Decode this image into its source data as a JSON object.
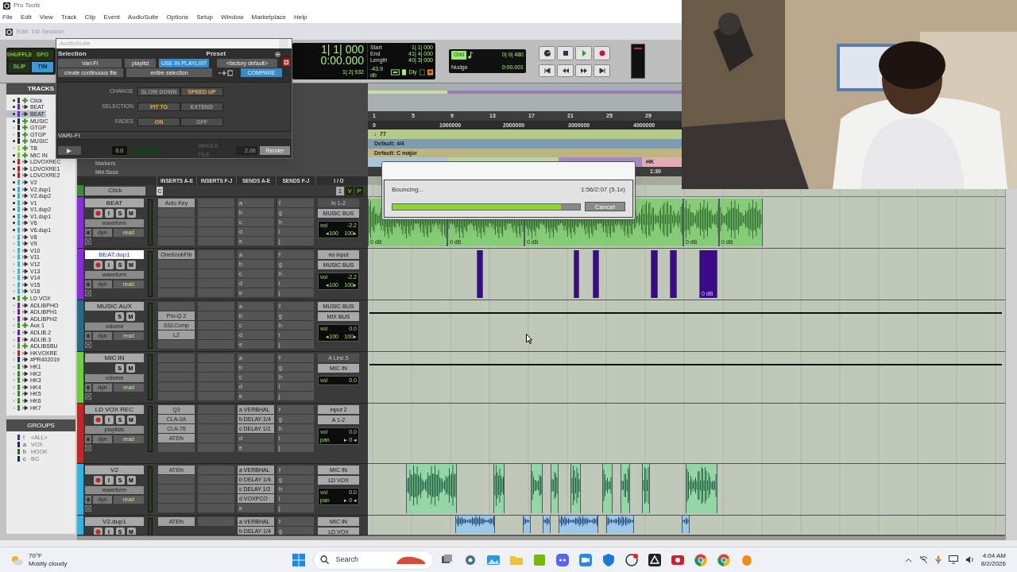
{
  "app_title": "Pro Tools",
  "menu": [
    "File",
    "Edit",
    "View",
    "Track",
    "Clip",
    "Event",
    "AudioSuite",
    "Options",
    "Setup",
    "Window",
    "Marketplace",
    "Help"
  ],
  "edit_window": {
    "title": "Edit: 1st Session"
  },
  "edit_modes": [
    {
      "label": "SHUFFLE",
      "selected": false
    },
    {
      "label": "SPO",
      "selected": false
    },
    {
      "label": "SLIP",
      "selected": false
    },
    {
      "label": "TIM",
      "selected": true
    }
  ],
  "counters": {
    "main": "1| 1| 000",
    "sub": "0:00.000",
    "cursor": "1| 2| 932",
    "start_label": "Start",
    "start": "1| 1| 000",
    "end_label": "End",
    "end": "41| 4| 000",
    "length_label": "Length",
    "length": "40| 3| 000",
    "db": "-43.9 db",
    "dly": "Dly"
  },
  "grid": {
    "label": "Grid",
    "value": "0| 0| 480",
    "nudge_label": "Nudge",
    "nudge": "0:00.001"
  },
  "audiosuite": {
    "title": "AudioSuite",
    "selection_label": "Selection",
    "preset_label": "Preset",
    "plugin": "Vari-Fi",
    "playlist": "playlist",
    "use_in_playlist": {
      "label": "USE IN PLAYLIST",
      "on": true
    },
    "preset": "<factory default>",
    "file_mode": "create continuous file",
    "scope": "entire selection",
    "compare": "COMPARE",
    "options": [
      {
        "label": "CHANGE",
        "choices": [
          {
            "label": "SLOW DOWN",
            "selected": false
          },
          {
            "label": "SPEED UP",
            "selected": true
          }
        ]
      },
      {
        "label": "SELECTION",
        "choices": [
          {
            "label": "FIT TO",
            "selected": true
          },
          {
            "label": "EXTEND",
            "selected": false
          }
        ]
      },
      {
        "label": "FADES",
        "choices": [
          {
            "label": "ON",
            "selected": true
          },
          {
            "label": "OFF",
            "selected": false
          }
        ]
      }
    ],
    "plugin_label": "VARI-FI",
    "meter_value": "0.0",
    "whole_file": "WHOLE FILE",
    "handle": "2.00",
    "render": "Render"
  },
  "tracks_panel": {
    "title": "TRACKS",
    "tracks": [
      {
        "name": "Click",
        "color": "#3a3a3a",
        "visible": true,
        "kind": "aux",
        "selected": false
      },
      {
        "name": "BEAT",
        "color": "#7a1fd6",
        "visible": true,
        "kind": "audio",
        "selected": false
      },
      {
        "name": "BEAT",
        "color": "#7a1fd6",
        "visible": true,
        "kind": "audio",
        "selected": true
      },
      {
        "name": "MUSIC",
        "color": "#2a2a2a",
        "visible": true,
        "kind": "aux",
        "selected": false
      },
      {
        "name": "GTGP",
        "color": "#2a2a2a",
        "visible": false,
        "kind": "aux",
        "selected": false
      },
      {
        "name": "GTGP",
        "color": "#2a2a2a",
        "visible": false,
        "kind": "aux",
        "selected": false
      },
      {
        "name": "MUSIC",
        "color": "#2a2a2a",
        "visible": true,
        "kind": "aux",
        "selected": false
      },
      {
        "name": "TB",
        "color": "#b4d44a",
        "visible": false,
        "kind": "aux",
        "selected": false
      },
      {
        "name": "MIC IN",
        "color": "#6bd13a",
        "visible": true,
        "kind": "aux",
        "selected": false
      },
      {
        "name": "LDVOXREC",
        "color": "#c82020",
        "visible": true,
        "kind": "audio",
        "selected": false
      },
      {
        "name": "LDVOXRE1",
        "color": "#c82020",
        "visible": true,
        "kind": "audio",
        "selected": false
      },
      {
        "name": "LDVOXRE2",
        "color": "#c82020",
        "visible": true,
        "kind": "audio",
        "selected": false
      },
      {
        "name": "V2",
        "color": "#39b8dc",
        "visible": true,
        "kind": "audio",
        "selected": false
      },
      {
        "name": "V2.dup1",
        "color": "#39b8dc",
        "visible": true,
        "kind": "audio",
        "selected": false
      },
      {
        "name": "V2.dup2",
        "color": "#39b8dc",
        "visible": true,
        "kind": "audio",
        "selected": false
      },
      {
        "name": "V1",
        "color": "#39b8dc",
        "visible": true,
        "kind": "audio",
        "selected": false
      },
      {
        "name": "V1.dup2",
        "color": "#39b8dc",
        "visible": true,
        "kind": "audio",
        "selected": false
      },
      {
        "name": "V1.dup1",
        "color": "#39b8dc",
        "visible": true,
        "kind": "audio",
        "selected": false
      },
      {
        "name": "V6",
        "color": "#39b8dc",
        "visible": true,
        "kind": "audio",
        "selected": false
      },
      {
        "name": "V6.dup1",
        "color": "#39b8dc",
        "visible": true,
        "kind": "audio",
        "selected": false
      },
      {
        "name": "V8",
        "color": "#39b8dc",
        "visible": false,
        "kind": "audio",
        "selected": false
      },
      {
        "name": "V9",
        "color": "#39b8dc",
        "visible": false,
        "kind": "audio",
        "selected": false
      },
      {
        "name": "V10",
        "color": "#39b8dc",
        "visible": false,
        "kind": "audio",
        "selected": false
      },
      {
        "name": "V11",
        "color": "#39b8dc",
        "visible": false,
        "kind": "audio",
        "selected": false
      },
      {
        "name": "V12",
        "color": "#39b8dc",
        "visible": false,
        "kind": "audio",
        "selected": false
      },
      {
        "name": "V13",
        "color": "#39b8dc",
        "visible": false,
        "kind": "audio",
        "selected": false
      },
      {
        "name": "V14",
        "color": "#39b8dc",
        "visible": false,
        "kind": "audio",
        "selected": false
      },
      {
        "name": "V15",
        "color": "#39b8dc",
        "visible": false,
        "kind": "audio",
        "selected": false
      },
      {
        "name": "V16",
        "color": "#39b8dc",
        "visible": false,
        "kind": "audio",
        "selected": false
      },
      {
        "name": "LD VOX",
        "color": "#3aa03a",
        "visible": true,
        "kind": "aux",
        "selected": false
      },
      {
        "name": "ADLIBPHO",
        "color": "#6a1fb0",
        "visible": false,
        "kind": "audio",
        "selected": false
      },
      {
        "name": "ADLIBPH1",
        "color": "#6a1fb0",
        "visible": false,
        "kind": "audio",
        "selected": false
      },
      {
        "name": "ADLIBPH2",
        "color": "#6a1fb0",
        "visible": false,
        "kind": "audio",
        "selected": false
      },
      {
        "name": "Aux 1",
        "color": "#2a8a2a",
        "visible": false,
        "kind": "aux",
        "selected": false
      },
      {
        "name": "ADLIB.2",
        "color": "#6a1fb0",
        "visible": false,
        "kind": "audio",
        "selected": false
      },
      {
        "name": "ADLIB.3",
        "color": "#6a1fb0",
        "visible": false,
        "kind": "audio",
        "selected": false
      },
      {
        "name": "ADLIBSBU",
        "color": "#3aa03a",
        "visible": false,
        "kind": "aux",
        "selected": false
      },
      {
        "name": "HKVOXRE",
        "color": "#c82020",
        "visible": false,
        "kind": "audio",
        "selected": false
      },
      {
        "name": "#PR402019",
        "color": "#1a2a6a",
        "visible": false,
        "kind": "audio",
        "selected": false
      },
      {
        "name": "HK1",
        "color": "#2a8a2a",
        "visible": false,
        "kind": "audio",
        "selected": false
      },
      {
        "name": "HK2",
        "color": "#2a8a2a",
        "visible": false,
        "kind": "audio",
        "selected": false
      },
      {
        "name": "HK3",
        "color": "#2a8a2a",
        "visible": false,
        "kind": "audio",
        "selected": false
      },
      {
        "name": "HK4",
        "color": "#2a8a2a",
        "visible": false,
        "kind": "audio",
        "selected": false
      },
      {
        "name": "HK5",
        "color": "#2a8a2a",
        "visible": false,
        "kind": "audio",
        "selected": false
      },
      {
        "name": "HK6",
        "color": "#2a8a2a",
        "visible": false,
        "kind": "audio",
        "selected": false
      },
      {
        "name": "HK7",
        "color": "#2a8a2a",
        "visible": false,
        "kind": "audio",
        "selected": false
      }
    ]
  },
  "groups_panel": {
    "title": "GROUPS",
    "groups": [
      {
        "letter": "!",
        "name": "<ALL>",
        "color": "#5a1fb0"
      },
      {
        "letter": "a",
        "name": "VOX",
        "color": "#1a2a6a"
      },
      {
        "letter": "b",
        "name": "HOOK",
        "color": "#4a5a1a"
      },
      {
        "letter": "c",
        "name": "BG",
        "color": "#1a2a6a"
      }
    ]
  },
  "rulers": {
    "labels": [
      "Markers",
      "Min:Secs"
    ],
    "bars": [
      "1",
      "5",
      "9",
      "13",
      "17",
      "21",
      "25",
      "29"
    ],
    "samples": [
      "0",
      "1000000",
      "2000000",
      "3000000",
      "4000000"
    ],
    "tempo": "♩77",
    "meter": "Default: 4/4",
    "key": "Default: C major",
    "marker": "HK",
    "min_secs": "1:30"
  },
  "mix_headers": [
    "INSERTS A-E",
    "INSERTS F-J",
    "SENDS A-E",
    "SENDS F-J",
    "I / O"
  ],
  "click_track": {
    "name": "Click",
    "insert": "C",
    "output": "1",
    "buttons": [
      "V",
      "P"
    ]
  },
  "strips": [
    {
      "name": "BEAT",
      "color": "#8a2be2",
      "kind": "audio",
      "name_selected": false,
      "buttons": [
        "I",
        "S",
        "M"
      ],
      "mode": "waveform",
      "dyn": "dyn",
      "auto": "read",
      "inserts": [
        {
          "kind": "plugin",
          "name": "Auto Key"
        },
        {
          "kind": "empty"
        },
        {
          "kind": "empty"
        },
        {
          "kind": "empty"
        },
        {
          "kind": "empty"
        }
      ],
      "sends_ae": [
        {
          "slot": "a"
        },
        {
          "slot": "b"
        },
        {
          "slot": "c"
        },
        {
          "slot": "d"
        },
        {
          "slot": "e"
        }
      ],
      "sends_fj": [
        "f",
        "g",
        "h",
        "i",
        "j"
      ],
      "input": {
        "label": "In 1-2",
        "active": false
      },
      "output": "MUSIC BUS",
      "vol_label": "vol",
      "vol": "-2.2",
      "pan": [
        "◂100",
        "100▸"
      ],
      "lane": {
        "kind": "waveform",
        "clip_labels": [
          "0 dB",
          "0 dB",
          "0 dB",
          "0 dB",
          "0 dB"
        ]
      }
    },
    {
      "name": "BEAT.dup1",
      "color": "#8a2be2",
      "kind": "audio",
      "name_selected": true,
      "buttons": [
        "I",
        "S",
        "M"
      ],
      "mode": "waveform",
      "dyn": "dyn",
      "auto": "read",
      "inserts": [
        {
          "kind": "plugin",
          "name": "OneKnobFltr"
        },
        {
          "kind": "empty"
        },
        {
          "kind": "empty"
        },
        {
          "kind": "empty"
        },
        {
          "kind": "empty"
        }
      ],
      "sends_ae": [
        {
          "slot": "a"
        },
        {
          "slot": "b"
        },
        {
          "slot": "c"
        },
        {
          "slot": "d"
        },
        {
          "slot": "e"
        }
      ],
      "sends_fj": [
        "f",
        "g",
        "h",
        "i",
        "j"
      ],
      "input": {
        "label": "no input",
        "active": true
      },
      "output": "MUSIC BUS",
      "vol_label": "vol",
      "vol": "-2.2",
      "pan": [
        "◂100",
        "100▸"
      ],
      "lane": {
        "kind": "blocks",
        "clip_labels": [
          "0 dB"
        ]
      }
    },
    {
      "name": "MUSIC AUX",
      "color": "#1f6f8b",
      "kind": "aux",
      "name_selected": false,
      "buttons": [
        "S",
        "M"
      ],
      "mode": "volume",
      "dyn": "dyn",
      "auto": "read",
      "inserts": [
        {
          "kind": "empty"
        },
        {
          "kind": "plugin",
          "name": "Pro-Q 2"
        },
        {
          "kind": "plugin",
          "name": "SSLComp"
        },
        {
          "kind": "plugin",
          "name": "L2"
        },
        {
          "kind": "empty"
        }
      ],
      "sends_ae": [
        {
          "slot": "a"
        },
        {
          "slot": "b"
        },
        {
          "slot": "c"
        },
        {
          "slot": "d"
        },
        {
          "slot": "e"
        }
      ],
      "sends_fj": [
        "f",
        "g",
        "h",
        "i",
        "j"
      ],
      "input": {
        "label": "MUSIC BUS",
        "active": true
      },
      "output": "MIX BUS",
      "vol_label": "vol",
      "vol": "0.0",
      "pan": [
        "◂100",
        "100▸"
      ],
      "lane": {
        "kind": "line"
      }
    },
    {
      "name": "MIC IN",
      "color": "#6ad13a",
      "kind": "aux",
      "name_selected": false,
      "buttons": [
        "S",
        "M"
      ],
      "mode": "volume",
      "dyn": "dyn",
      "auto": "read",
      "inserts": [
        {
          "kind": "empty"
        },
        {
          "kind": "empty"
        },
        {
          "kind": "empty"
        },
        {
          "kind": "empty"
        },
        {
          "kind": "empty"
        }
      ],
      "sends_ae": [
        {
          "slot": "a"
        },
        {
          "slot": "b"
        },
        {
          "slot": "c"
        },
        {
          "slot": "d"
        },
        {
          "slot": "e"
        }
      ],
      "sends_fj": [
        "f",
        "g",
        "h",
        "i",
        "j"
      ],
      "input": {
        "label": "A Line 5",
        "active": false
      },
      "output": "MIC IN",
      "vol_label": "vol",
      "vol": "0.0",
      "lane": {
        "kind": "line"
      }
    },
    {
      "name": "LD VOX REC",
      "color": "#cc2222",
      "kind": "audio",
      "name_selected": false,
      "buttons": [
        "I",
        "S",
        "M"
      ],
      "mode": "playlists",
      "dyn": "dyn",
      "auto": "read",
      "inserts": [
        {
          "kind": "plugin",
          "name": "Q3"
        },
        {
          "kind": "plugin",
          "name": "CLA-2A"
        },
        {
          "kind": "plugin",
          "name": "CLA-76"
        },
        {
          "kind": "plugin",
          "name": "ATEfx"
        },
        {
          "kind": "empty"
        }
      ],
      "sends_ae": [
        {
          "slot": "a",
          "name": "VERBHAL"
        },
        {
          "slot": "b",
          "name": "DELAY 1/4"
        },
        {
          "slot": "c",
          "name": "DELAY 1/2"
        },
        {
          "slot": "d"
        },
        {
          "slot": "e"
        }
      ],
      "sends_fj": [
        "f",
        "g",
        "h",
        "i",
        "j"
      ],
      "input": {
        "label": "Input 2",
        "active": true
      },
      "output": "A 1-2",
      "vol_label": "vol",
      "vol": "0.0",
      "pan_label": "pan",
      "pan": [
        "▸ 0 ◂"
      ],
      "lane": {
        "kind": "empty"
      }
    },
    {
      "name": "V2",
      "color": "#29b6e8",
      "kind": "audio",
      "name_selected": false,
      "buttons": [
        "I",
        "S",
        "M"
      ],
      "mode": "waveform",
      "dyn": "dyn",
      "auto": "read",
      "inserts": [
        {
          "kind": "plugin",
          "name": "ATEfx"
        },
        {
          "kind": "empty"
        },
        {
          "kind": "empty"
        },
        {
          "kind": "empty"
        },
        {
          "kind": "empty"
        }
      ],
      "sends_ae": [
        {
          "slot": "a",
          "name": "VERBHAL"
        },
        {
          "slot": "b",
          "name": "DELAY 1/4"
        },
        {
          "slot": "c",
          "name": "DELAY 1/2"
        },
        {
          "slot": "d",
          "name": "VOXPCO"
        },
        {
          "slot": "e"
        }
      ],
      "sends_fj": [
        "f",
        "g",
        "h",
        "i",
        "j"
      ],
      "input": {
        "label": "MIC IN",
        "active": true
      },
      "output": "LD VOX",
      "vol_label": "vol",
      "vol": "0.0",
      "pan_label": "pan",
      "pan": [
        "▸ 0 ◂"
      ],
      "lane": {
        "kind": "vocal"
      }
    },
    {
      "name": "V2.dup1",
      "color": "#29b6e8",
      "kind": "audio",
      "name_selected": false,
      "buttons": [
        "I",
        "S",
        "M"
      ],
      "inserts": [
        {
          "kind": "plugin",
          "name": "ATEfx"
        }
      ],
      "sends_ae": [
        {
          "slot": "a",
          "name": "VERBHAL"
        },
        {
          "slot": "b",
          "name": "DELAY 1/4"
        }
      ],
      "sends_fj": [
        "f",
        "g"
      ],
      "input": {
        "label": "MIC IN",
        "active": true
      },
      "output": "LD VOX",
      "lane": {
        "kind": "vocal_small"
      }
    }
  ],
  "bounce_dialog": {
    "message": "Bouncing...",
    "time": "1:56/2:07 (5.1x)",
    "level": 0.9,
    "cancel": "Cancel"
  },
  "taskbar": {
    "temperature": "70°F",
    "weather": "Mostly cloudy",
    "search": "Search",
    "time": "4:04 AM",
    "date": "8/2/2026"
  }
}
